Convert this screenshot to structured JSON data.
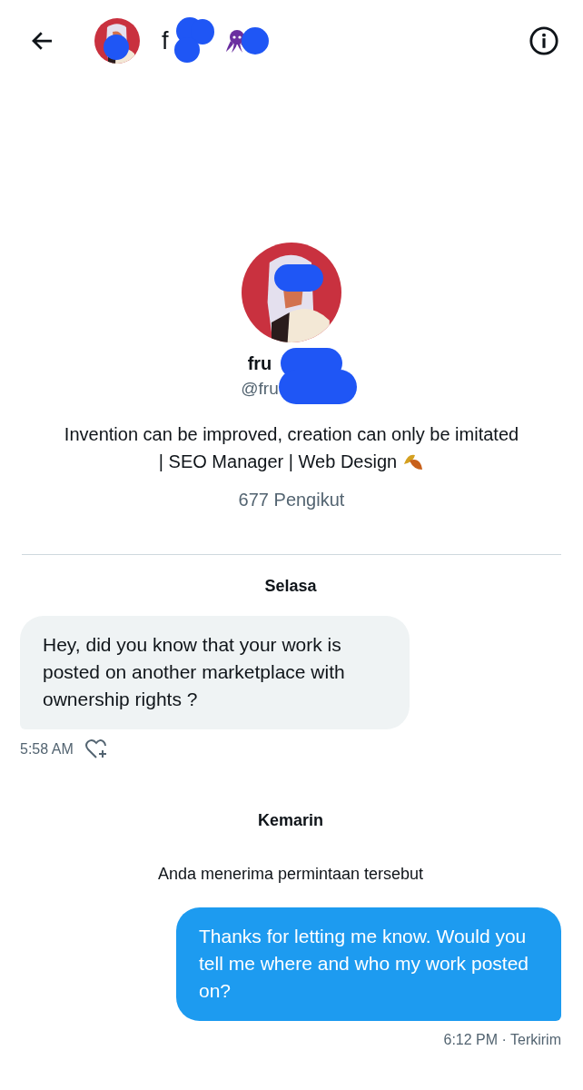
{
  "header": {
    "name": "f"
  },
  "profile": {
    "name": "fru",
    "handle": "@fru",
    "bio_lines": [
      "Invention can be improved, creation can only be imitated",
      "| SEO Manager | Web Design"
    ],
    "followers": "677 Pengikut"
  },
  "messages": [
    {
      "kind": "date",
      "text": "Selasa"
    },
    {
      "kind": "received",
      "text": "Hey, did you know that your work is posted on another marketplace with ownership rights ?",
      "time": "5:58 AM"
    },
    {
      "kind": "date",
      "text": "Kemarin"
    },
    {
      "kind": "notice",
      "text": "Anda menerima permintaan tersebut"
    },
    {
      "kind": "sent",
      "text": "Thanks for letting me know. Would you tell me where and who my work posted on?",
      "meta": "6:12 PM · Terkirim"
    }
  ]
}
